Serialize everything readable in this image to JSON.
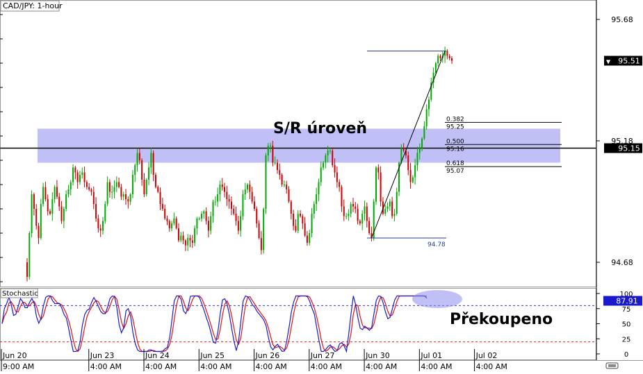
{
  "chart_data": {
    "type": "candlestick",
    "title": "CAD/JPY: 1-hour",
    "price_axis": {
      "ylim": [
        94.58,
        95.76
      ],
      "ticks": [
        95.68,
        95.18,
        94.68
      ],
      "current_price_label": "95.51",
      "level_label": "95.15"
    },
    "x_ticks": [
      {
        "line1": "Jun 20",
        "line2": "9:00 AM",
        "index": 0
      },
      {
        "line1": "Jun 23",
        "line2": "4:00 AM",
        "index": 19
      },
      {
        "line1": "Jun 24",
        "line2": "4:00 AM",
        "index": 43
      },
      {
        "line1": "Jun 25",
        "line2": "4:00 AM",
        "index": 67
      },
      {
        "line1": "Jun 26",
        "line2": "4:00 AM",
        "index": 91
      },
      {
        "line1": "Jun 27",
        "line2": "4:00 AM",
        "index": 115
      },
      {
        "line1": "Jun 30",
        "line2": "4:00 AM",
        "index": 139
      },
      {
        "line1": "Jul 01",
        "line2": "4:00 AM",
        "index": 163
      },
      {
        "line1": "Jul 02",
        "line2": "4:00 AM",
        "index": 187
      }
    ],
    "closes": [
      94.62,
      94.8,
      94.96,
      94.9,
      94.83,
      94.78,
      94.92,
      94.99,
      94.94,
      94.89,
      94.88,
      94.94,
      94.99,
      94.95,
      94.91,
      94.85,
      94.9,
      94.96,
      94.98,
      95.01,
      95.07,
      95.05,
      95.01,
      95.04,
      95.05,
      95.01,
      94.99,
      94.98,
      94.97,
      94.92,
      94.86,
      94.82,
      94.81,
      94.85,
      94.92,
      95.01,
      94.97,
      94.97,
      94.99,
      95.01,
      94.99,
      94.95,
      94.96,
      94.94,
      94.93,
      94.96,
      95.04,
      95.08,
      95.13,
      95.1,
      95.02,
      94.96,
      95.02,
      95.07,
      95.13,
      95.04,
      94.99,
      94.97,
      94.92,
      94.9,
      94.86,
      94.85,
      94.82,
      94.84,
      94.86,
      94.82,
      94.77,
      94.79,
      94.77,
      94.75,
      94.78,
      94.77,
      94.76,
      94.82,
      94.86,
      94.86,
      94.88,
      94.89,
      94.85,
      94.81,
      94.87,
      94.93,
      94.93,
      94.96,
      95.0,
      94.99,
      94.97,
      94.94,
      94.93,
      94.9,
      94.88,
      94.85,
      94.81,
      94.87,
      94.96,
      94.98,
      95.0,
      94.97,
      94.93,
      94.9,
      94.84,
      94.78,
      94.73,
      94.9,
      95.12,
      95.16,
      95.16,
      95.09,
      95.09,
      95.06,
      95.04,
      95.0,
      95.0,
      94.98,
      94.93,
      94.88,
      94.83,
      94.81,
      94.88,
      94.87,
      94.84,
      94.79,
      94.76,
      94.8,
      94.88,
      94.92,
      94.96,
      95.01,
      95.07,
      95.09,
      95.12,
      95.14,
      95.14,
      95.08,
      95.05,
      95.01,
      94.99,
      94.91,
      94.87,
      94.87,
      94.88,
      94.92,
      94.91,
      94.9,
      94.85,
      94.84,
      94.88,
      94.91,
      94.85,
      94.8,
      94.78,
      94.93,
      95.07,
      95.05,
      94.93,
      94.88,
      94.9,
      94.91,
      94.93,
      94.87,
      94.88,
      94.97,
      95.09,
      95.15,
      95.14,
      95.12,
      95.06,
      95.01,
      95.03,
      95.08,
      95.13,
      95.15,
      95.19,
      95.24,
      95.31,
      95.35,
      95.42,
      95.46,
      95.5,
      95.53,
      95.52,
      95.53,
      95.55,
      95.53,
      95.52,
      95.51
    ],
    "sr_zone": {
      "label": "S/R úroveň",
      "low": 95.09,
      "high": 95.23
    },
    "horizontal_level": 95.15,
    "fibonacci": {
      "swing_low": 94.78,
      "swing_high": 95.55,
      "swing_low_label": "94.78",
      "levels": [
        {
          "ratio": "0.382",
          "price": "95.25",
          "value": 95.256
        },
        {
          "ratio": "0.500",
          "price": "95.16",
          "value": 95.165
        },
        {
          "ratio": "0.618",
          "price": "95.07",
          "value": 95.074
        }
      ]
    },
    "stochastic": {
      "title": "Stochastic",
      "ylim": [
        0,
        100
      ],
      "ticks": [
        100,
        75,
        50,
        25,
        0
      ],
      "upper_level": 80,
      "lower_level": 20,
      "current_label": "87.91",
      "annotation": "Překoupeno"
    },
    "colors": {
      "bull": "#00aa00",
      "bear": "#cc0000",
      "zone": "#8c8cf0",
      "fib": "#1f3f8f",
      "k_line": "#1a1acc",
      "d_line": "#dd1111",
      "ellipse": "#8c8cf0"
    }
  }
}
